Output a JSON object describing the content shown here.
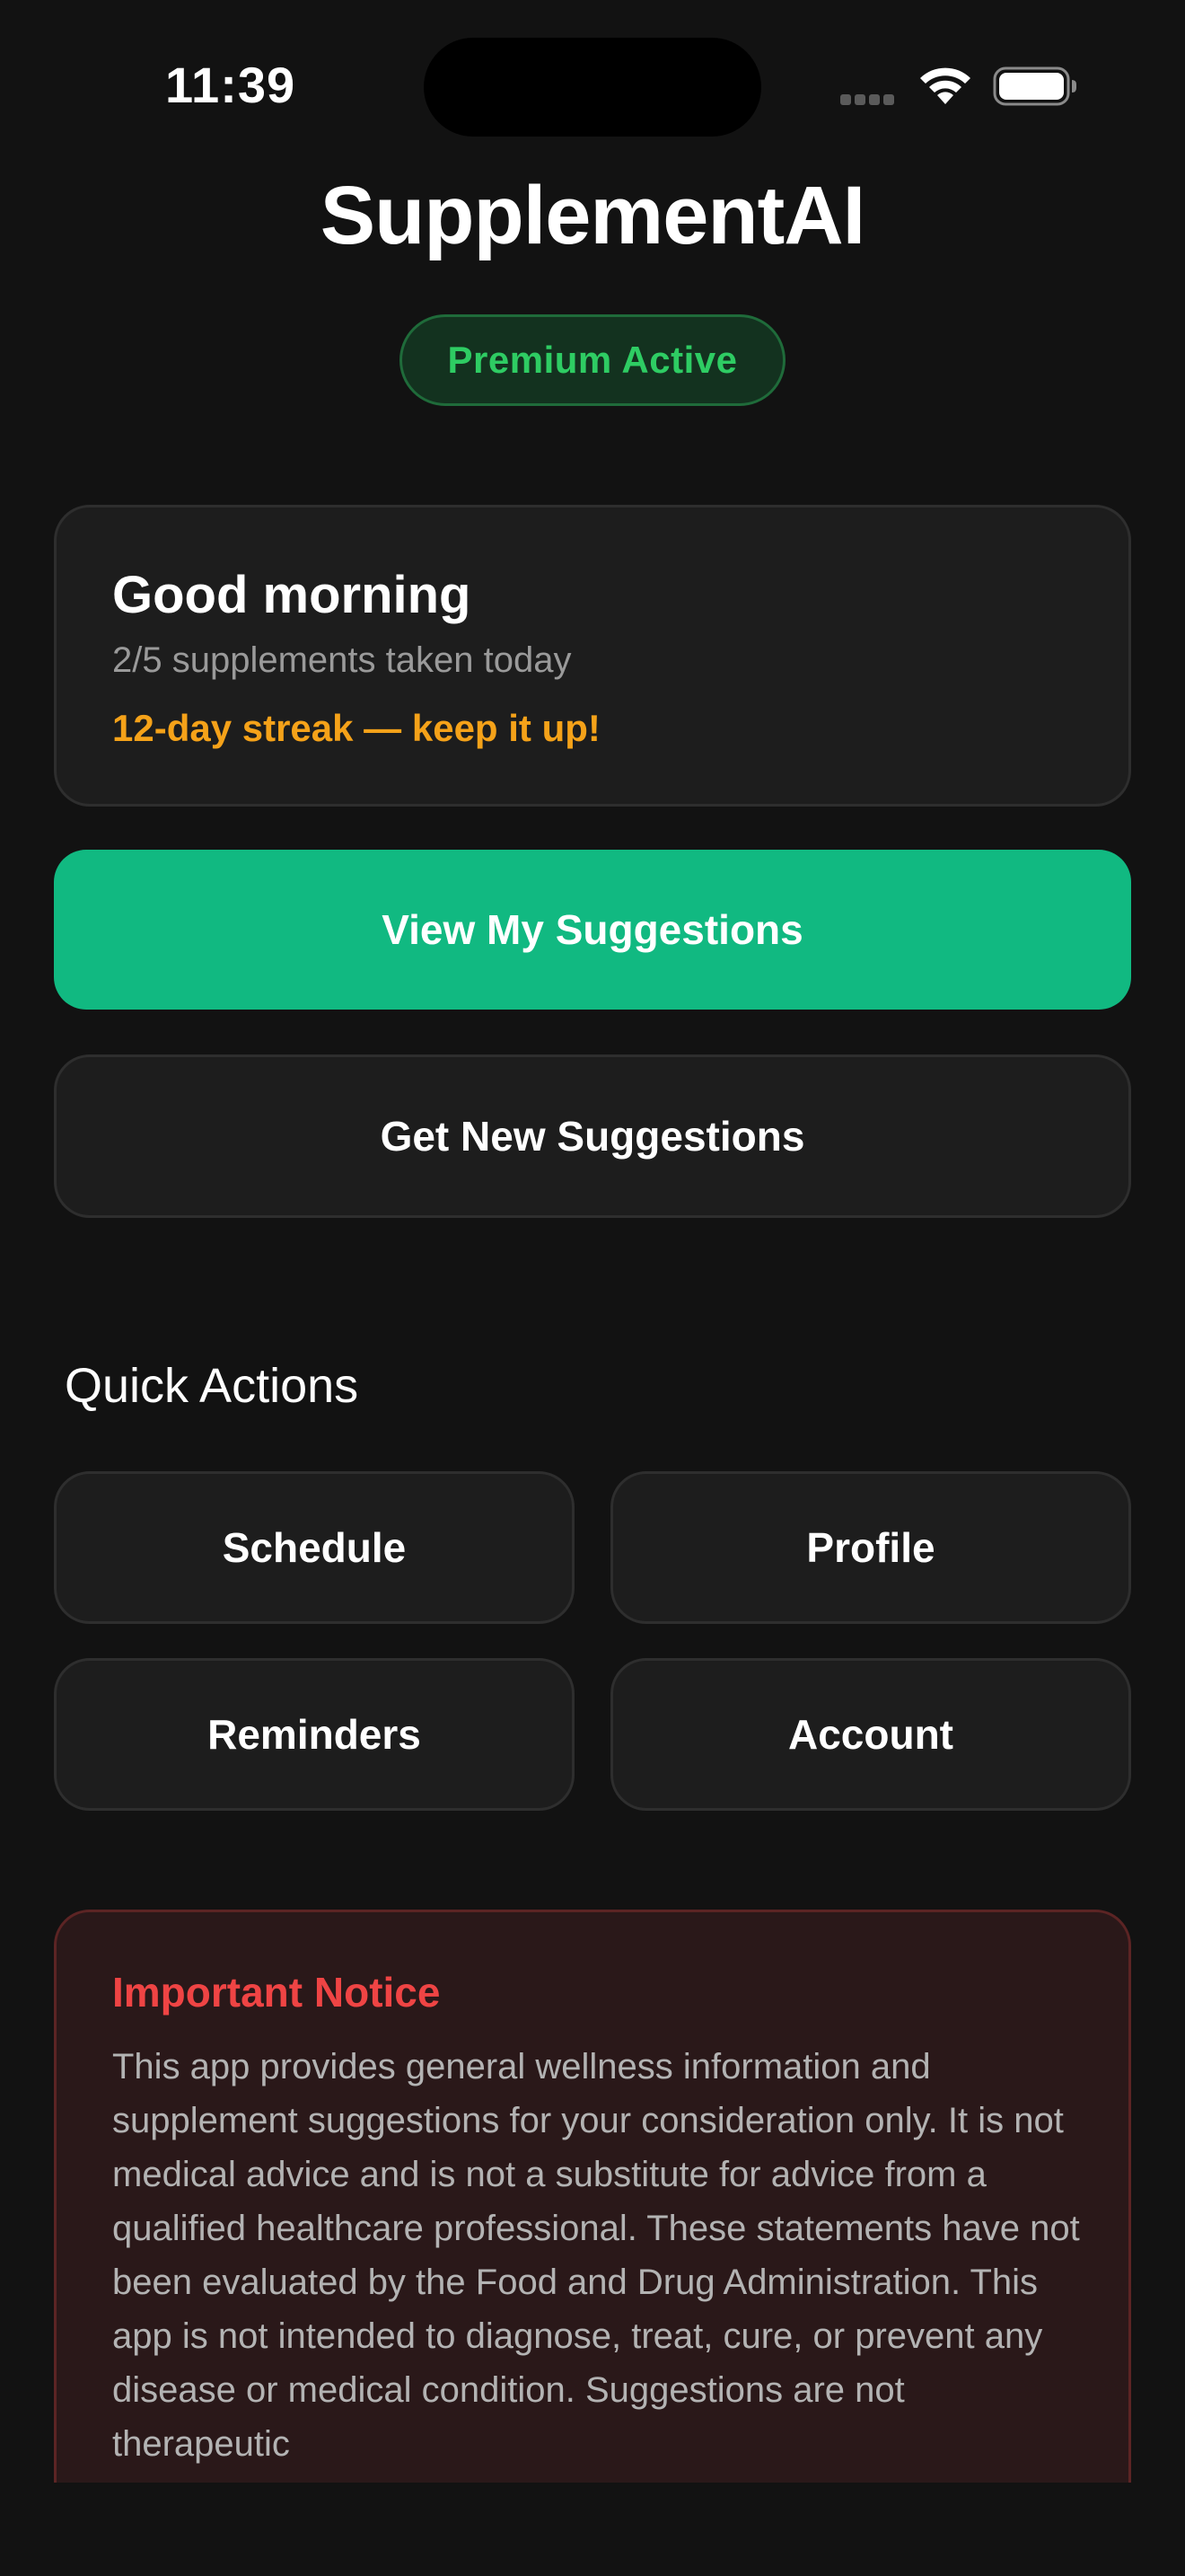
{
  "status_bar": {
    "time": "11:39",
    "icons": [
      "signal-dots-icon",
      "wifi-icon",
      "battery-icon"
    ]
  },
  "header": {
    "title": "SupplementAI",
    "badge": "Premium Active"
  },
  "greeting_card": {
    "title": "Good morning",
    "progress": "2/5 supplements taken today",
    "streak": "12-day streak — keep it up!"
  },
  "actions": {
    "primary_label": "View My Suggestions",
    "secondary_label": "Get New Suggestions"
  },
  "quick_actions": {
    "title": "Quick Actions",
    "items": [
      {
        "label": "Schedule"
      },
      {
        "label": "Profile"
      },
      {
        "label": "Reminders"
      },
      {
        "label": "Account"
      }
    ]
  },
  "notice": {
    "title": "Important Notice",
    "body": "This app provides general wellness information and supplement suggestions for your consideration only. It is not medical advice and is not a substitute for advice from a qualified healthcare professional. These statements have not been evaluated by the Food and Drug Administration. This app is not intended to diagnose, treat, cure, or prevent any disease or medical condition. Suggestions are not therapeutic"
  },
  "colors": {
    "background": "#121212",
    "accent_green": "#11b981",
    "badge_green": "#2ecc63",
    "streak_orange": "#f5a219",
    "notice_red": "#ef4444"
  }
}
